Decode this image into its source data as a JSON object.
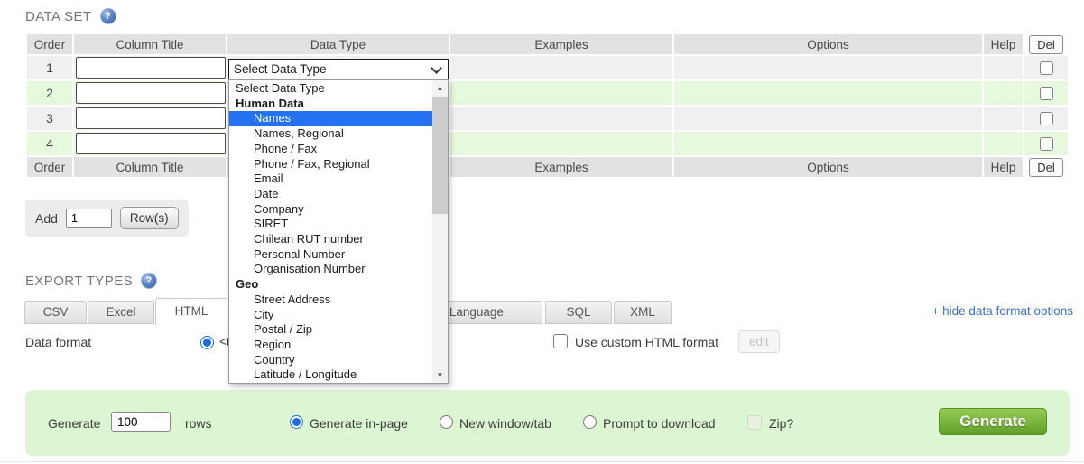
{
  "dataset": {
    "title": "DATA SET",
    "columns": [
      "Order",
      "Column Title",
      "Data Type",
      "Examples",
      "Options",
      "Help",
      "Del"
    ],
    "rows": [
      {
        "order": "1",
        "column_title": ""
      },
      {
        "order": "2",
        "column_title": ""
      },
      {
        "order": "3",
        "column_title": ""
      },
      {
        "order": "4",
        "column_title": ""
      }
    ],
    "add_rows": {
      "label": "Add",
      "value": "1",
      "button_label": "Row(s)"
    }
  },
  "data_type_dropdown": {
    "selected_value": "Select Data Type",
    "options": [
      {
        "label": "Select Data Type"
      },
      {
        "label": "Human Data"
      },
      {
        "label": "Names",
        "highlighted": true
      },
      {
        "label": "Names, Regional"
      },
      {
        "label": "Phone / Fax"
      },
      {
        "label": "Phone / Fax, Regional"
      },
      {
        "label": "Email"
      },
      {
        "label": "Date"
      },
      {
        "label": "Company"
      },
      {
        "label": "SIRET"
      },
      {
        "label": "Chilean RUT number"
      },
      {
        "label": "Personal Number"
      },
      {
        "label": "Organisation Number"
      },
      {
        "label": "Geo"
      },
      {
        "label": "Street Address"
      },
      {
        "label": "City"
      },
      {
        "label": "Postal / Zip"
      },
      {
        "label": "Region"
      },
      {
        "label": "Country"
      },
      {
        "label": "Latitude / Longitude"
      }
    ]
  },
  "export_types": {
    "title": "EXPORT TYPES",
    "tabs": [
      {
        "label": "CSV"
      },
      {
        "label": "Excel"
      },
      {
        "label": "HTML",
        "active": true
      },
      {
        "label": "Programming Language"
      },
      {
        "label": "SQL"
      },
      {
        "label": "XML"
      }
    ],
    "hide_link": "+ hide data format options",
    "data_format_label": "Data format",
    "data_format_value_fragment": "<t",
    "custom_html_label": "Use custom HTML format",
    "edit_button_label": "edit"
  },
  "generate_bar": {
    "generate_label": "Generate",
    "rows_value": "100",
    "rows_label": "rows",
    "options": [
      {
        "label": "Generate in-page",
        "selected": true
      },
      {
        "label": "New window/tab",
        "selected": false
      },
      {
        "label": "Prompt to download",
        "selected": false
      }
    ],
    "zip_label": "Zip?",
    "generate_button_label": "Generate"
  },
  "colors": {
    "highlight_blue": "#2472f2",
    "link_blue": "#3b6fd4",
    "generate_green": "#61a02a",
    "bar_green": "#dcf5d2",
    "row_green": "#e7f9dd",
    "row_gray": "#f0f0f0",
    "header_gray": "#e2e2e2"
  }
}
